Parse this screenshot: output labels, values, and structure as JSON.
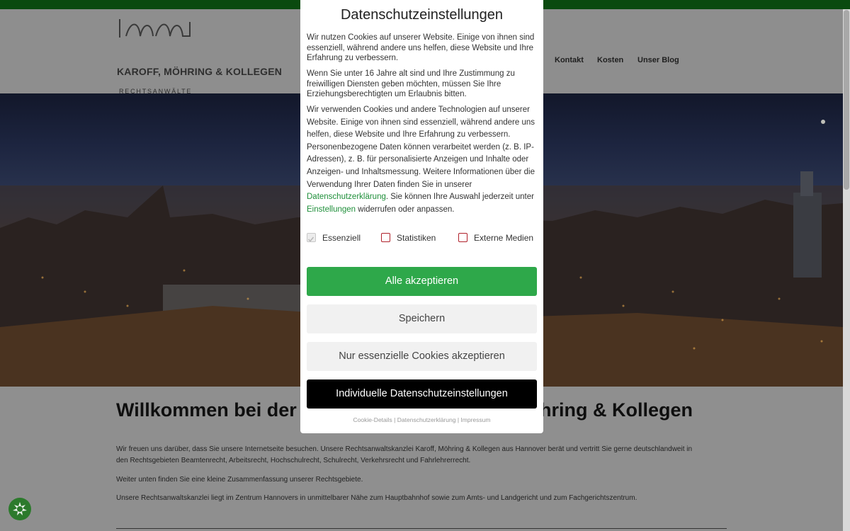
{
  "header": {
    "firm_name": "KAROFF, MÖHRING & KOLLEGEN",
    "firm_sub": "RECHTSANWÄLTE",
    "nav": [
      "Kontakt",
      "Kosten",
      "Unser Blog"
    ]
  },
  "content": {
    "welcome_left": "Willkommen bei der Re",
    "welcome_right": "hring & Kollegen",
    "p1": "Wir freuen uns darüber, dass Sie unsere Internetseite besuchen. Unsere Rechtsanwaltskanzlei Karoff, Möhring & Kollegen aus Hannover berät und vertritt Sie gerne deutschlandweit in den Rechtsgebieten Beamtenrecht, Arbeitsrecht, Hochschulrecht, Schulrecht, Verkehrsrecht und Fahrlehrerrecht.",
    "p2": "Weiter unten finden Sie eine kleine Zusammenfassung unserer Rechtsgebiete.",
    "p3": "Unsere Rechtsanwaltskanzlei liegt im Zentrum Hannovers in unmittelbarer Nähe zum Hauptbahnhof sowie zum Amts- und Landgericht und zum Fachgerichtszentrum."
  },
  "modal": {
    "title": "Datenschutzeinstellungen",
    "intro1": "Wir nutzen Cookies auf unserer Website. Einige von ihnen sind essenziell, während andere uns helfen, diese Website und Ihre Erfahrung zu verbessern.",
    "intro2": "Wenn Sie unter 16 Jahre alt sind und Ihre Zustimmung zu freiwilligen Diensten geben möchten, müssen Sie Ihre Erziehungsberechtigten um Erlaubnis bitten.",
    "intro3_a": "Wir verwenden Cookies und andere Technologien auf unserer Website. Einige von ihnen sind essenziell, während andere uns helfen, diese Website und Ihre Erfahrung zu verbessern. Personenbezogene Daten können verarbeitet werden (z. B. IP-Adressen), z. B. für personalisierte Anzeigen und Inhalte oder Anzeigen- und Inhaltsmessung. Weitere Informationen über die Verwendung Ihrer Daten finden Sie in unserer ",
    "intro3_link1": "Datenschutzerklärung",
    "intro3_b": ". Sie können Ihre Auswahl jederzeit unter ",
    "intro3_link2": "Einstellungen",
    "intro3_c": " widerrufen oder anpassen.",
    "checkboxes": [
      {
        "label": "Essenziell",
        "checked": true,
        "disabled": true
      },
      {
        "label": "Statistiken",
        "checked": false,
        "disabled": false
      },
      {
        "label": "Externe Medien",
        "checked": false,
        "disabled": false
      }
    ],
    "buttons": {
      "accept_all": "Alle akzeptieren",
      "save": "Speichern",
      "essential_only": "Nur essenzielle Cookies akzeptieren",
      "individual": "Individuelle Datenschutzeinstellungen"
    },
    "footer": {
      "cookie_details": "Cookie-Details",
      "privacy": "Datenschutzerklärung",
      "imprint": "Impressum",
      "sep": "|"
    }
  },
  "colors": {
    "accent_green": "#2ea84a",
    "topbar": "#0a4a0f",
    "checkbox_border": "#b0202a"
  }
}
